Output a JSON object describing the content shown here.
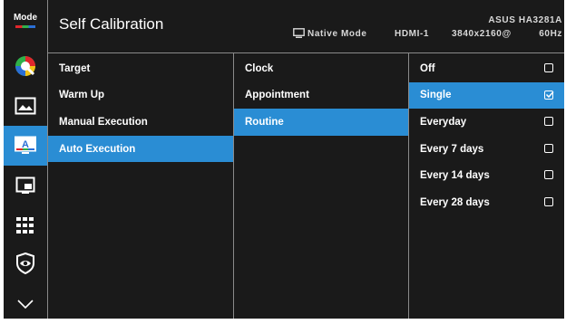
{
  "sidebar": {
    "items": [
      {
        "name": "mode",
        "label": "Mode"
      },
      {
        "name": "color-palette-icon"
      },
      {
        "name": "image-icon"
      },
      {
        "name": "calibration-icon",
        "active": true
      },
      {
        "name": "pip-icon"
      },
      {
        "name": "input-grid-icon"
      },
      {
        "name": "eye-shield-icon"
      },
      {
        "name": "chevron-down-icon"
      }
    ]
  },
  "header": {
    "title": "Self Calibration",
    "mode": "Native Mode",
    "input": "HDMI-1",
    "resolution": "3840x2160@",
    "model": "ASUS HA3281A",
    "refresh": "60Hz"
  },
  "menu": {
    "col1": [
      "Target",
      "Warm Up",
      "Manual Execution",
      "Auto Execution"
    ],
    "col1_selected": 3,
    "col2": [
      "Clock",
      "Appointment",
      "Routine"
    ],
    "col2_selected": 2,
    "col3": [
      {
        "label": "Off",
        "checked": false
      },
      {
        "label": "Single",
        "checked": true
      },
      {
        "label": "Everyday",
        "checked": false
      },
      {
        "label": "Every 7 days",
        "checked": false
      },
      {
        "label": "Every 14 days",
        "checked": false
      },
      {
        "label": "Every 28 days",
        "checked": false
      }
    ],
    "col3_selected": 1
  },
  "colors": {
    "accent": "#2a8dd4",
    "background": "#1a1a1a",
    "divider": "#8a8a8a"
  }
}
